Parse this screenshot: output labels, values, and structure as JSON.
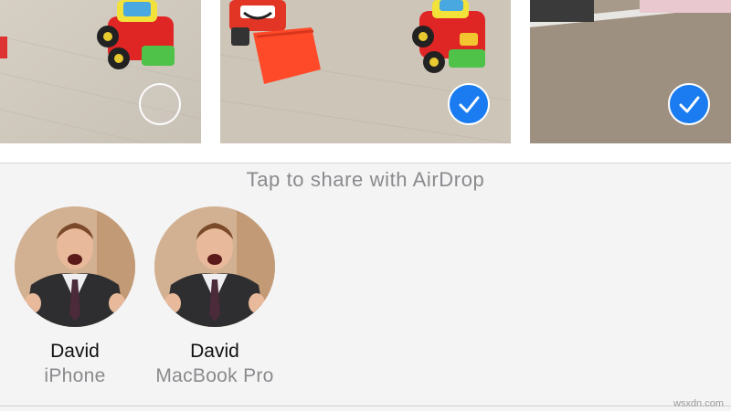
{
  "photos": [
    {
      "subject": "toy-truck",
      "selected": false
    },
    {
      "subject": "toy-bulldozer-and-truck",
      "selected": true
    },
    {
      "subject": "desk-object",
      "selected": true
    }
  ],
  "colors": {
    "accent": "#1a7cf0",
    "hint_text": "#8a8a8e",
    "background": "#f4f4f4"
  },
  "airdrop": {
    "hint": "Tap to share with AirDrop",
    "devices": [
      {
        "name": "David",
        "type": "iPhone"
      },
      {
        "name": "David",
        "type": "MacBook Pro"
      }
    ]
  },
  "watermark": "wsxdn.com"
}
